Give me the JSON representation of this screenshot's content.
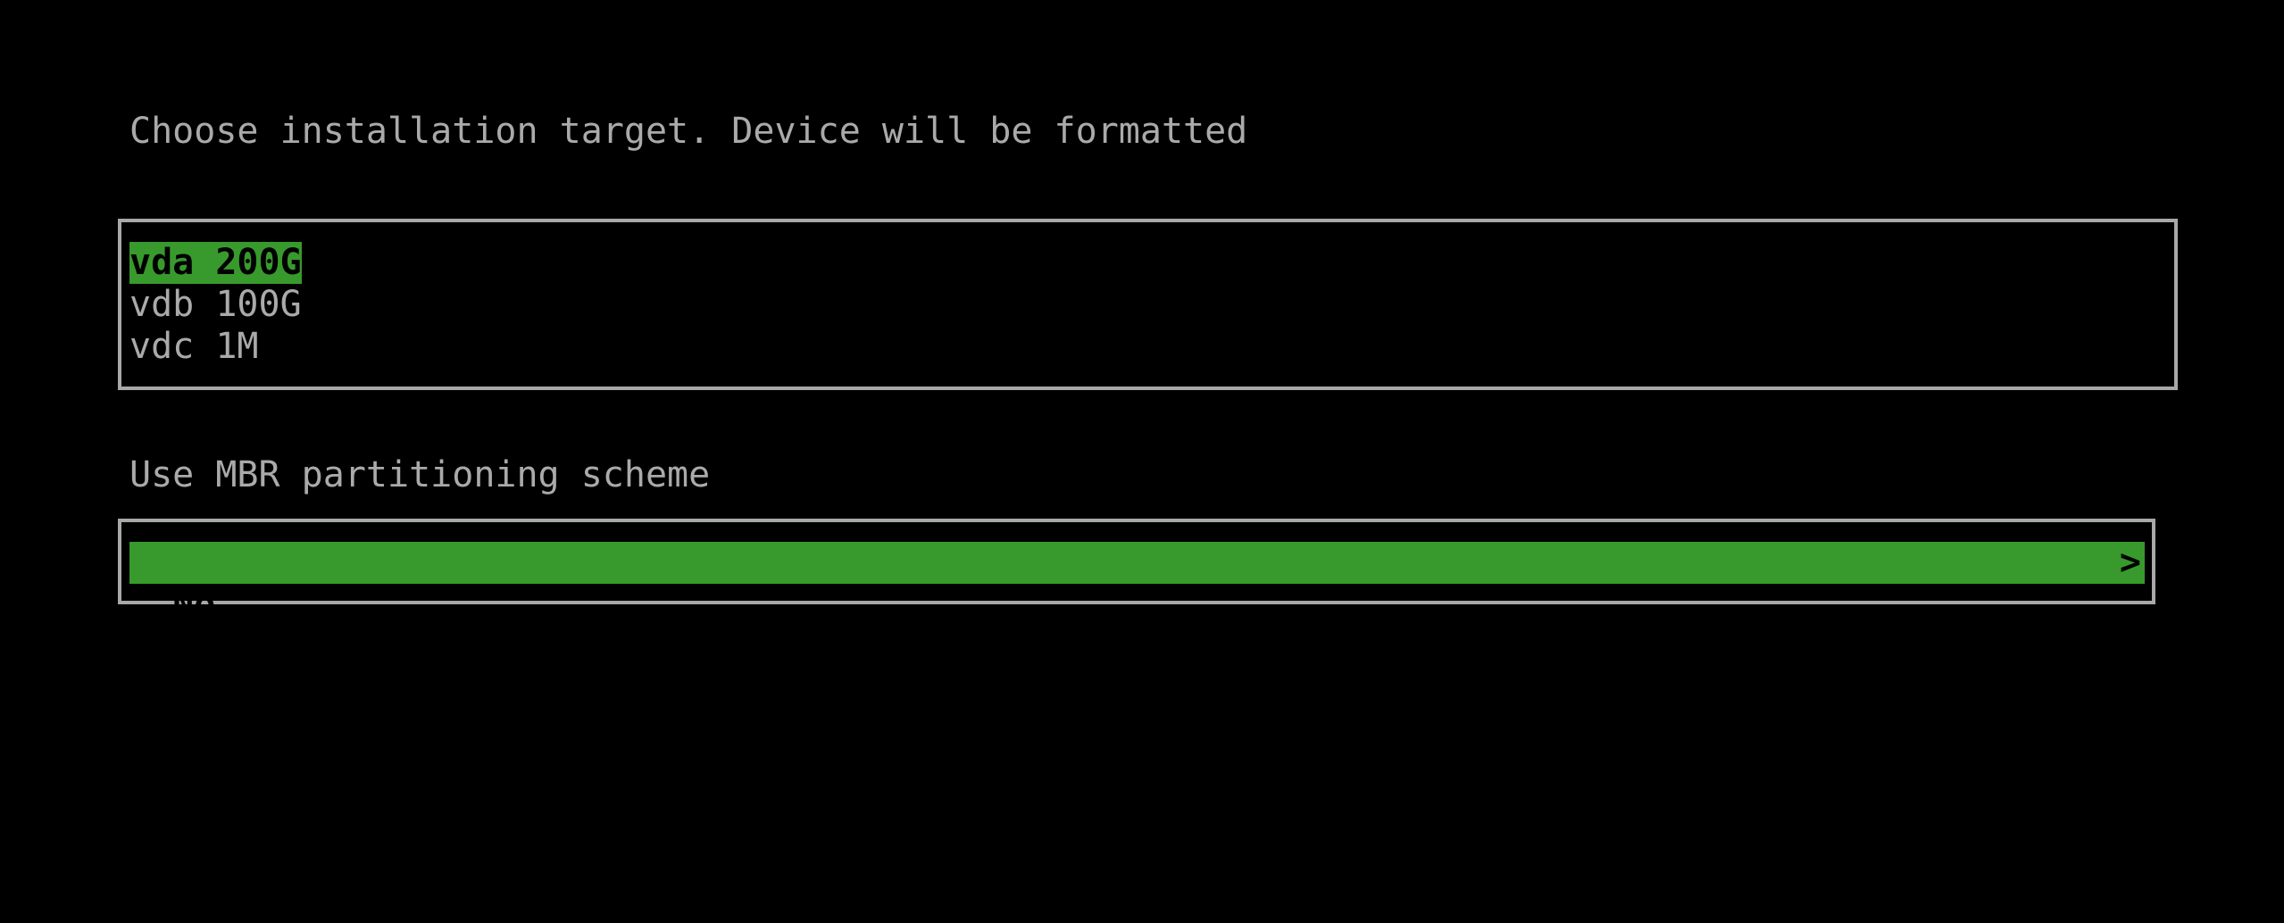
{
  "target_prompt": "Choose installation target. Device will be formatted",
  "devices": [
    {
      "label": "vda 200G",
      "selected": true
    },
    {
      "label": "vdb 100G",
      "selected": false
    },
    {
      "label": "vdc 1M",
      "selected": false
    }
  ],
  "mbr_prompt": "Use MBR partitioning scheme",
  "mbr_value": "No",
  "mbr_arrow": ">",
  "colors": {
    "highlight": "#389a2c",
    "text": "#aaaaaa",
    "background": "#000000"
  }
}
